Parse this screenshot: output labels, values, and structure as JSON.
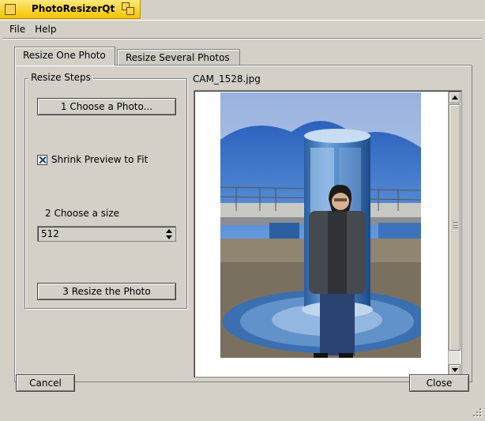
{
  "window": {
    "title": "PhotoResizerQt",
    "accent_color": "#f5c400"
  },
  "menubar": {
    "file_label": "File",
    "help_label": "Help"
  },
  "tabs": [
    {
      "label": "Resize One Photo",
      "active": true
    },
    {
      "label": "Resize Several Photos",
      "active": false
    }
  ],
  "resize_steps": {
    "group_title": "Resize Steps",
    "choose_photo_label": "1 Choose a Photo...",
    "shrink_preview_label": "Shrink Preview to Fit",
    "shrink_preview_checked": true,
    "choose_size_label": "2 Choose a size",
    "size_value": "512",
    "resize_label": "3 Resize the Photo"
  },
  "preview": {
    "filename": "CAM_1528.jpg"
  },
  "footer": {
    "cancel_label": "Cancel",
    "close_label": "Close"
  }
}
